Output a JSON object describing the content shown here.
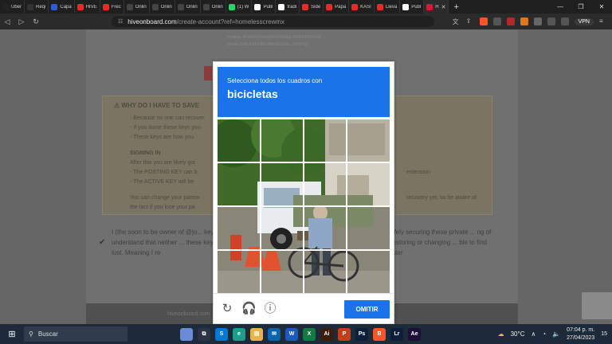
{
  "browser": {
    "tabs": [
      {
        "label": "Uber",
        "color": "#222222"
      },
      {
        "label": "Reqi",
        "color": "#333333"
      },
      {
        "label": "Capa",
        "color": "#2f5bd3"
      },
      {
        "label": "HIVE",
        "color": "#e52d27"
      },
      {
        "label": "Frec",
        "color": "#e52d27"
      },
      {
        "label": "Onlin",
        "color": "#444444"
      },
      {
        "label": "Onlin",
        "color": "#444444"
      },
      {
        "label": "Onlin",
        "color": "#444444"
      },
      {
        "label": "Onlin",
        "color": "#444444"
      },
      {
        "label": "(1) W",
        "color": "#25d366"
      },
      {
        "label": "Publ",
        "color": "#ffffff"
      },
      {
        "label": "tradi",
        "color": "#ffffff"
      },
      {
        "label": "Side",
        "color": "#e52d27"
      },
      {
        "label": "Papa",
        "color": "#e52d27"
      },
      {
        "label": "KASI",
        "color": "#e52d27"
      },
      {
        "label": "Lleva",
        "color": "#e52d27"
      },
      {
        "label": "Publ",
        "color": "#ffffff"
      },
      {
        "label": "H",
        "color": "#e31337",
        "active": true
      }
    ],
    "new_tab": "+",
    "url_host": "hiveonboard.com",
    "url_path": "/create-account?ref=homelesscrewmx",
    "vpn_label": "VPN"
  },
  "page": {
    "keys_lines": [
      "Posting:  5KePA7o6RaXMvKH4RRpL7W8hbDXGF9E...",
      "Memo:     5JBzK4AX9MxAHeq6dgGV...X7mPQ2"
    ],
    "warn_title": "WHY DO I HAVE TO SAVE",
    "warn_lines": [
      "- Because no one can recover",
      "- If you loose these keys you",
      "- These keys are how you",
      "SIGNING IN",
      "After this you are likely goi",
      "- The POSTING KEY can b",
      "- The ACTIVE KEY will be",
      "You can change your passw",
      "the fact if you lose your pa"
    ],
    "warn_right_lines": [
      "extension",
      "recovery yet, so be aware of"
    ],
    "agree_left": "I (the soon to be owner of @jo... keys. I understand that neither ... these keys if lost. Meaning I re",
    "agree_right": "afely securing these private ... ng of restoring or changing ... ble to find later",
    "footer_text": "hiveonboard.com"
  },
  "captcha": {
    "instruction": "Selecciona todos los cuadros con",
    "object": "bicicletas",
    "skip_label": "OMITIR",
    "accent": "#1a73e8"
  },
  "taskbar": {
    "search_placeholder": "Buscar",
    "temperature": "30°C",
    "time": "07:04 p. m.",
    "date": "27/04/2023",
    "notification_count": "15",
    "apps": [
      {
        "label": "",
        "color": "#6a8bd6"
      },
      {
        "label": "⧉",
        "color": "#2a3444"
      },
      {
        "label": "S",
        "color": "#0078d4"
      },
      {
        "label": "e",
        "color": "#1d9e8a"
      },
      {
        "label": "▤",
        "color": "#e8b44a"
      },
      {
        "label": "✉",
        "color": "#0a64ad"
      },
      {
        "label": "W",
        "color": "#185abd"
      },
      {
        "label": "X",
        "color": "#107c41"
      },
      {
        "label": "Ai",
        "color": "#3b1d0a"
      },
      {
        "label": "P",
        "color": "#c43e1c"
      },
      {
        "label": "Ps",
        "color": "#0b1f3a"
      },
      {
        "label": "B",
        "color": "#fb542b"
      },
      {
        "label": "Lr",
        "color": "#0b1f3a"
      },
      {
        "label": "Ae",
        "color": "#1e0f3a"
      }
    ]
  }
}
